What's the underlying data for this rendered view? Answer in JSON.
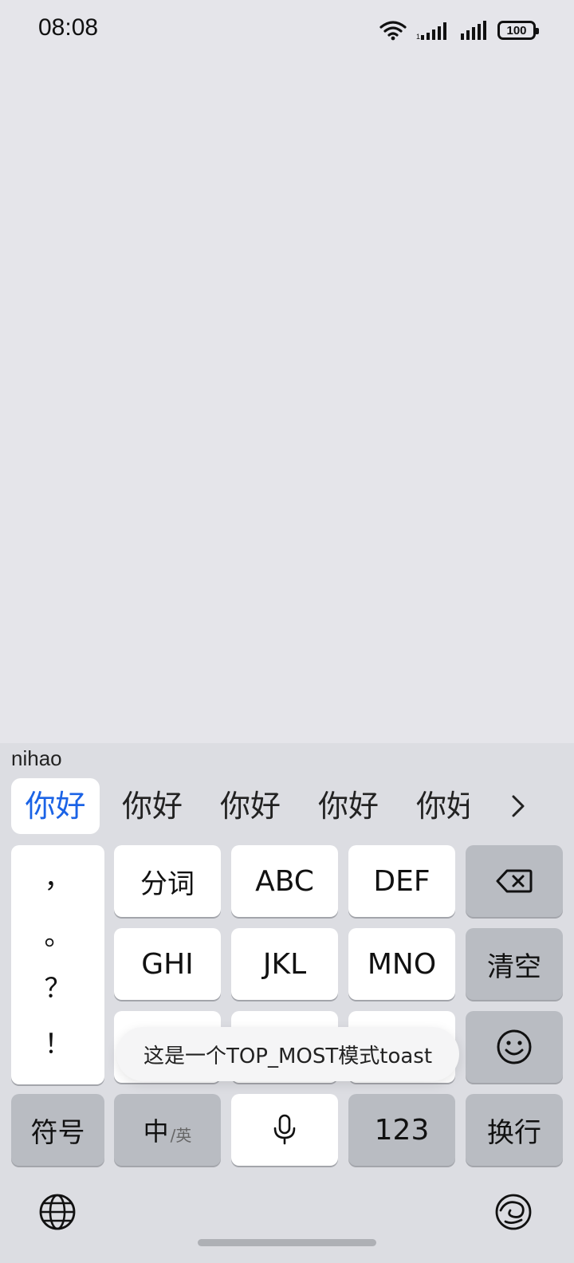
{
  "status_bar": {
    "time": "08:08",
    "battery": "100"
  },
  "keyboard": {
    "pinyin": "nihao",
    "candidates": [
      "你好",
      "你好",
      "你好",
      "你好",
      "你好"
    ],
    "keys": {
      "seg": "分词",
      "abc": "ABC",
      "def": "DEF",
      "ghi": "GHI",
      "jkl": "JKL",
      "mno": "MNO",
      "clear": "清空",
      "symbols": "符号",
      "zh_main": "中",
      "zh_sub": "/英",
      "num": "123",
      "enter": "换行"
    },
    "punctuation": [
      "，",
      "。",
      "？",
      "！"
    ]
  },
  "toast": {
    "text": "这是一个TOP_MOST模式toast"
  },
  "colors": {
    "accent": "#1b63e6",
    "keyboard_bg": "#dcdde2",
    "function_key": "#b9bcc2"
  }
}
